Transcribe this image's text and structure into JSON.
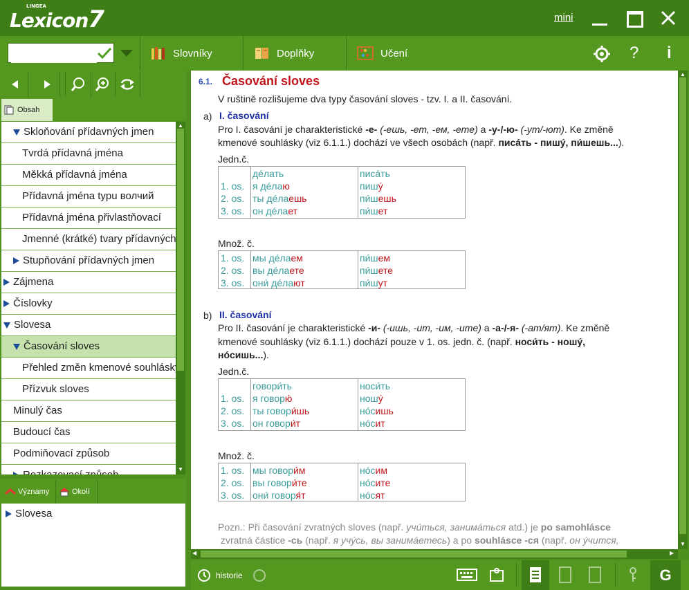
{
  "app": {
    "brand": "LINGEA",
    "name": "Lexicon",
    "version": "7",
    "mini_label": "mini"
  },
  "toolbar": {
    "search_value": "",
    "dict_label": "Slovníky",
    "addons_label": "Doplňky",
    "learn_label": "Učení"
  },
  "left": {
    "tab_contents": "Obsah",
    "tree": [
      {
        "label": "Skloňování přídavných jmen",
        "level": 1,
        "toggle": "down"
      },
      {
        "label": "Tvrdá přídavná jména",
        "level": 2
      },
      {
        "label": "Měkká přídavná jména",
        "level": 2
      },
      {
        "label": "Přídavná jména typu волчий",
        "level": 2
      },
      {
        "label": "Přídavná jména přivlastňovací",
        "level": 2
      },
      {
        "label": "Jmenné (krátké) tvary přídavných",
        "level": 2
      },
      {
        "label": "Stupňování přídavných jmen",
        "level": 1,
        "toggle": "right"
      },
      {
        "label": "Zájmena",
        "level": 0,
        "toggle": "right"
      },
      {
        "label": "Číslovky",
        "level": 0,
        "toggle": "right"
      },
      {
        "label": "Slovesa",
        "level": 0,
        "toggle": "down"
      },
      {
        "label": "Časování sloves",
        "level": 1,
        "toggle": "down",
        "selected": true
      },
      {
        "label": "Přehled změn kmenové souhlásky",
        "level": 2
      },
      {
        "label": "Přízvuk sloves",
        "level": 2
      },
      {
        "label": "Minulý čas",
        "level": 1
      },
      {
        "label": "Budoucí čas",
        "level": 1
      },
      {
        "label": "Podmiňovací způsob",
        "level": 1
      },
      {
        "label": "Rozkazovací způsob",
        "level": 1,
        "toggle": "right"
      }
    ],
    "tab_meanings": "Významy",
    "tab_surroundings": "Okolí",
    "bottom_item": "Slovesa"
  },
  "content": {
    "section_num": "6.1.",
    "title": "Časování sloves",
    "intro": "V ruštině rozlišujeme dva typy časování sloves - tzv. I. a II. časování.",
    "a_marker": "a)",
    "a_title": "I. časování",
    "a_p1_pre": "Pro I. časování je charakteristické ",
    "a_p1_b1": "-е-",
    "a_p1_i1": " (-ешь, -ет, -ем, -ете)",
    "a_p1_mid": " a ",
    "a_p1_b2": "-у-/-ю-",
    "a_p1_i2": " (-ут/-ют)",
    "a_p1_post": ". Ke změně",
    "a_p2_pre": "kmenové souhlásky (viz 6.1.1.) dochází ve všech osobách (např. ",
    "a_p2_b": "писáть - пишý, пи́шешь...",
    "a_p2_post": ").",
    "sg_label": "Jedn.č.",
    "pl_label": "Množ. č.",
    "persons_sg": [
      "1. os.",
      "2. os.",
      "3. os."
    ],
    "persons_pl": [
      "1. os.",
      "2. os.",
      "3. os."
    ],
    "t1_head": [
      "дéлать",
      "писáть"
    ],
    "t1_sg": [
      [
        [
          "я дéла",
          "ю"
        ],
        [
          "пиш",
          "ý"
        ]
      ],
      [
        [
          "ты дéла",
          "ешь"
        ],
        [
          "пи́ш",
          "ешь"
        ]
      ],
      [
        [
          "он дéла",
          "ет"
        ],
        [
          "пи́ш",
          "ет"
        ]
      ]
    ],
    "t1_pl": [
      [
        [
          "мы дéла",
          "ем"
        ],
        [
          "пи́ш",
          "ем"
        ]
      ],
      [
        [
          "вы дéла",
          "ете"
        ],
        [
          "пи́ш",
          "ете"
        ]
      ],
      [
        [
          "они́ дéла",
          "ют"
        ],
        [
          "пи́ш",
          "ут"
        ]
      ]
    ],
    "b_marker": "b)",
    "b_title": "II. časování",
    "b_p1_pre": "Pro II. časování je charakteristické ",
    "b_p1_b1": "-и-",
    "b_p1_i1": " (-ишь, -ит, -им, -ите)",
    "b_p1_mid": " a ",
    "b_p1_b2": "-а-/-я-",
    "b_p1_i2": " (-ат/ят)",
    "b_p1_post": ". Ke změně",
    "b_p2_pre": "kmenové souhlásky (viz 6.1.1.) dochází pouze v 1. os. jedn. č. (např. ",
    "b_p2_b": "носи́ть - ношý,",
    "b_p3_b": "нóсишь...",
    "b_p3_post": ").",
    "t2_head": [
      "говори́ть",
      "носи́ть"
    ],
    "t2_sg": [
      [
        [
          "я говор",
          "ю́"
        ],
        [
          "нош",
          "ý"
        ]
      ],
      [
        [
          "ты говор",
          "и́шь"
        ],
        [
          "нóс",
          "ишь"
        ]
      ],
      [
        [
          "он говор",
          "и́т"
        ],
        [
          "нóс",
          "ит"
        ]
      ]
    ],
    "t2_pl": [
      [
        [
          "мы говор",
          "и́м"
        ],
        [
          "нóс",
          "им"
        ]
      ],
      [
        [
          "вы говор",
          "и́те"
        ],
        [
          "нóс",
          "ите"
        ]
      ],
      [
        [
          "они́ говор",
          "я́т"
        ],
        [
          "нóс",
          "ят"
        ]
      ]
    ],
    "note_l1_pre": "Pozn.: Při časování zvratných sloves (např. ",
    "note_l1_i": "учи́ться, занимáться",
    "note_l1_mid": " atd.) je ",
    "note_l1_b": "po samohlásce",
    "note_l2_pre": "zvratná částice ",
    "note_l2_b": "-сь",
    "note_l2_mid": " (např. ",
    "note_l2_i": "я учýсь, вы занимáетесь",
    "note_l2_mid2": ") a po ",
    "note_l2_b2": "souhlásce -ся",
    "note_l2_mid3": " (např. ",
    "note_l2_i2": "он ýчится,"
  },
  "status": {
    "history_label": "historie"
  }
}
